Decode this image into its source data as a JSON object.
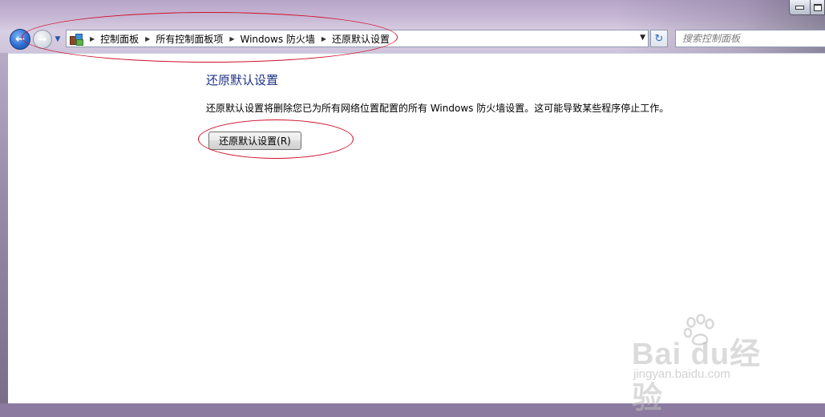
{
  "address_bar": {
    "breadcrumbs": [
      {
        "label": "控制面板"
      },
      {
        "label": "所有控制面板项"
      },
      {
        "label": "Windows 防火墙"
      },
      {
        "label": "还原默认设置"
      }
    ]
  },
  "search": {
    "placeholder": "搜索控制面板"
  },
  "main": {
    "title": "还原默认设置",
    "description": "还原默认设置将删除您已为所有网络位置配置的所有 Windows 防火墙设置。这可能导致某些程序停止工作。",
    "restore_button_label": "还原默认设置(R)"
  },
  "icons": {
    "back": "back-arrow-icon",
    "forward": "forward-arrow-icon",
    "recent": "chevron-down-icon",
    "location": "control-panel-icon",
    "refresh": "refresh-icon"
  },
  "watermark": {
    "brand": "Bai du",
    "brand_suffix": "经验",
    "url": "jingyan.baidu.com"
  },
  "colors": {
    "title": "#1e3287",
    "annotation": "#d0102a"
  }
}
